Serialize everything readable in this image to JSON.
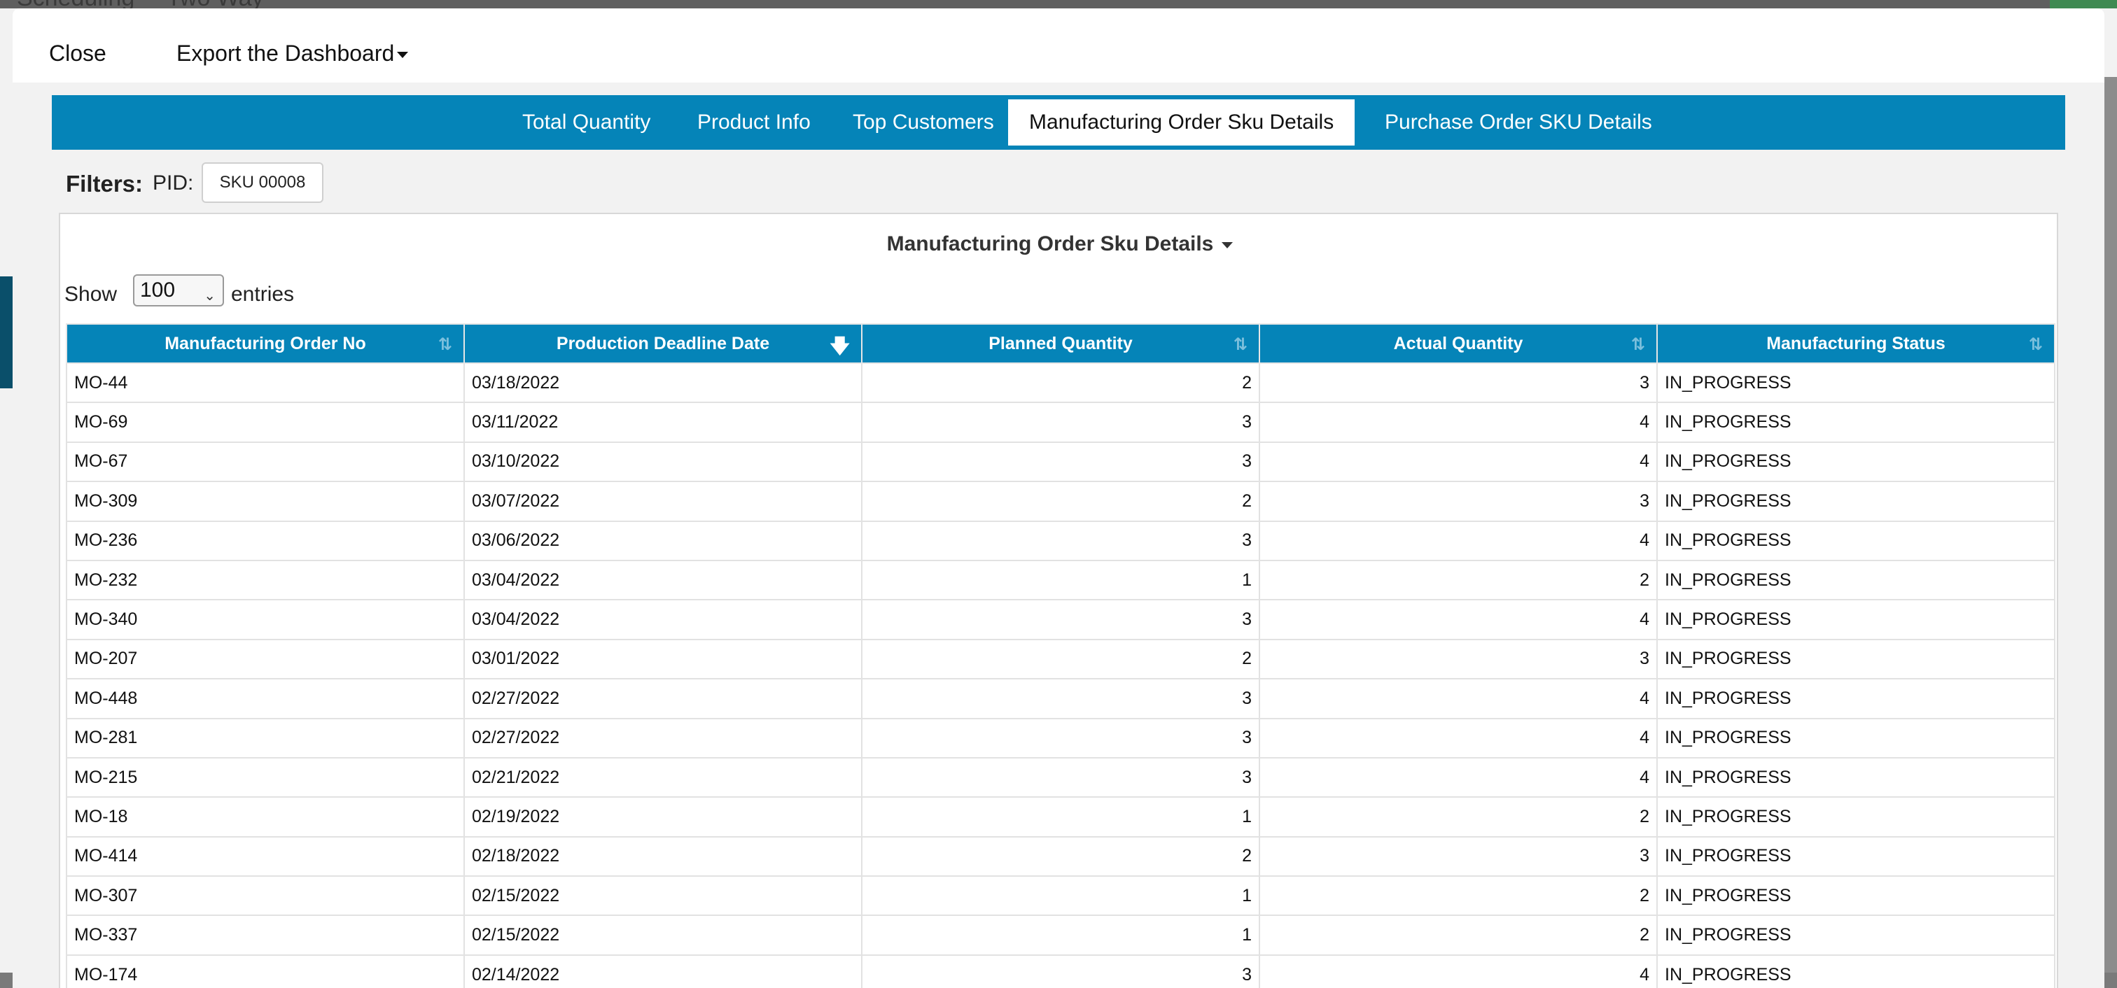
{
  "background": {
    "topbar_items": [
      "Scheduling",
      "Two Way"
    ]
  },
  "modal": {
    "close_label": "Close",
    "export_label": "Export the Dashboard",
    "tabs": [
      {
        "label": "Total Quantity",
        "active": false
      },
      {
        "label": "Product Info",
        "active": false
      },
      {
        "label": "Top Customers",
        "active": false
      },
      {
        "label": "Manufacturing Order Sku Details",
        "active": true
      },
      {
        "label": "Purchase Order SKU Details",
        "active": false
      }
    ],
    "filters": {
      "label": "Filters:",
      "pid_label": "PID:",
      "pid_value": "SKU 00008"
    },
    "panel": {
      "title": "Manufacturing Order Sku Details",
      "show_label": "Show",
      "entries_value": "100",
      "entries_label": "entries"
    },
    "table": {
      "columns": [
        "Manufacturing Order No",
        "Production Deadline Date",
        "Planned Quantity",
        "Actual Quantity",
        "Manufacturing Status"
      ],
      "rows": [
        [
          "MO-44",
          "03/18/2022",
          "2",
          "3",
          "IN_PROGRESS"
        ],
        [
          "MO-69",
          "03/11/2022",
          "3",
          "4",
          "IN_PROGRESS"
        ],
        [
          "MO-67",
          "03/10/2022",
          "3",
          "4",
          "IN_PROGRESS"
        ],
        [
          "MO-309",
          "03/07/2022",
          "2",
          "3",
          "IN_PROGRESS"
        ],
        [
          "MO-236",
          "03/06/2022",
          "3",
          "4",
          "IN_PROGRESS"
        ],
        [
          "MO-232",
          "03/04/2022",
          "1",
          "2",
          "IN_PROGRESS"
        ],
        [
          "MO-340",
          "03/04/2022",
          "3",
          "4",
          "IN_PROGRESS"
        ],
        [
          "MO-207",
          "03/01/2022",
          "2",
          "3",
          "IN_PROGRESS"
        ],
        [
          "MO-448",
          "02/27/2022",
          "3",
          "4",
          "IN_PROGRESS"
        ],
        [
          "MO-281",
          "02/27/2022",
          "3",
          "4",
          "IN_PROGRESS"
        ],
        [
          "MO-215",
          "02/21/2022",
          "3",
          "4",
          "IN_PROGRESS"
        ],
        [
          "MO-18",
          "02/19/2022",
          "1",
          "2",
          "IN_PROGRESS"
        ],
        [
          "MO-414",
          "02/18/2022",
          "2",
          "3",
          "IN_PROGRESS"
        ],
        [
          "MO-307",
          "02/15/2022",
          "1",
          "2",
          "IN_PROGRESS"
        ],
        [
          "MO-337",
          "02/15/2022",
          "1",
          "2",
          "IN_PROGRESS"
        ],
        [
          "MO-174",
          "02/14/2022",
          "3",
          "4",
          "IN_PROGRESS"
        ]
      ]
    }
  },
  "colors": {
    "accent": "#0584b8",
    "header_text": "#ffffff"
  }
}
